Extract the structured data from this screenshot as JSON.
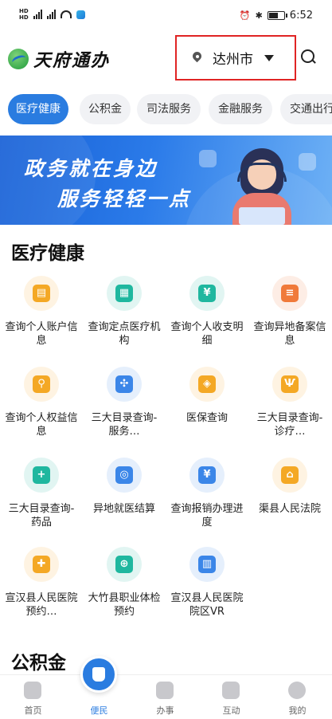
{
  "status_bar": {
    "time": "6:52",
    "battery_level": 0.65
  },
  "header": {
    "city": "达州市",
    "logo_text": "天府通办"
  },
  "tabs": [
    "医疗健康",
    "公积金",
    "司法服务",
    "金融服务",
    "交通出行"
  ],
  "banner": {
    "line1": "政务就在身边",
    "line2": "服务轻轻一点"
  },
  "section": {
    "title": "医疗健康",
    "next_title": "公积金"
  },
  "services": [
    {
      "label": "查询个人账户信息",
      "icon": "id-card-icon",
      "color": "#f4a825"
    },
    {
      "label": "查询定点医疗机构",
      "icon": "hospital-icon",
      "color": "#1fb79f"
    },
    {
      "label": "查询个人收支明细",
      "icon": "ledger-icon",
      "color": "#1fb79f"
    },
    {
      "label": "查询异地备案信息",
      "icon": "record-icon",
      "color": "#f07a3a"
    },
    {
      "label": "查询个人权益信息",
      "icon": "rights-icon",
      "color": "#f4a825"
    },
    {
      "label": "三大目录查询-服务…",
      "icon": "apps-icon",
      "color": "#3b86e8"
    },
    {
      "label": "医保查询",
      "icon": "shield-icon",
      "color": "#f4a825"
    },
    {
      "label": "三大目录查询-诊疗…",
      "icon": "stethoscope-icon",
      "color": "#f4a825"
    },
    {
      "label": "三大目录查询-药品",
      "icon": "medicine-icon",
      "color": "#1fb79f"
    },
    {
      "label": "异地就医结算",
      "icon": "settle-icon",
      "color": "#3b86e8"
    },
    {
      "label": "查询报销办理进度",
      "icon": "reimburse-icon",
      "color": "#3b86e8"
    },
    {
      "label": "渠县人民法院",
      "icon": "court-icon",
      "color": "#f4a825"
    },
    {
      "label": "宣汉县人民医院预约…",
      "icon": "appointment-icon",
      "color": "#f4a825"
    },
    {
      "label": "大竹县职业体检预约",
      "icon": "checkup-icon",
      "color": "#1fb79f"
    },
    {
      "label": "宣汉县人民医院院区VR",
      "icon": "vr-hospital-icon",
      "color": "#3b86e8"
    }
  ],
  "bottom_nav": [
    {
      "label": "首页",
      "icon": "home-icon"
    },
    {
      "label": "便民",
      "icon": "convenience-icon"
    },
    {
      "label": "办事",
      "icon": "affairs-icon"
    },
    {
      "label": "互动",
      "icon": "interact-icon"
    },
    {
      "label": "我的",
      "icon": "profile-icon"
    }
  ]
}
